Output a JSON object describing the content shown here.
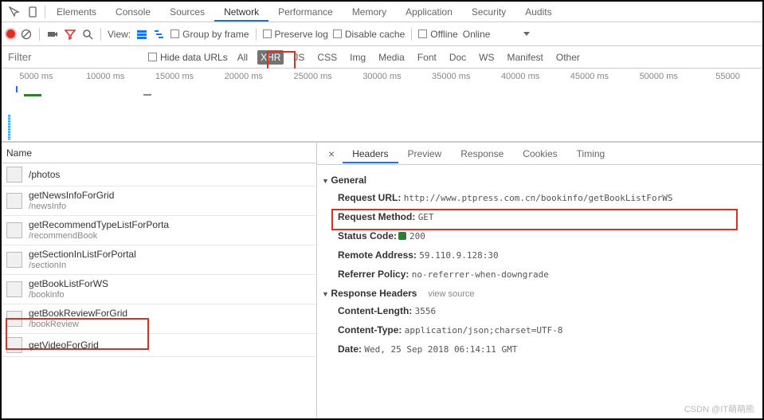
{
  "top_tabs": {
    "t0": "Elements",
    "t1": "Console",
    "t2": "Sources",
    "t3": "Network",
    "t4": "Performance",
    "t5": "Memory",
    "t6": "Application",
    "t7": "Security",
    "t8": "Audits"
  },
  "toolbar": {
    "view": "View:",
    "group": "Group by frame",
    "preserve": "Preserve log",
    "disable": "Disable cache",
    "offline": "Offline",
    "online": "Online"
  },
  "filter": {
    "placeholder": "Filter",
    "hide": "Hide data URLs",
    "types": {
      "all": "All",
      "xhr": "XHR",
      "js": "JS",
      "css": "CSS",
      "img": "Img",
      "media": "Media",
      "font": "Font",
      "doc": "Doc",
      "ws": "WS",
      "manifest": "Manifest",
      "other": "Other"
    }
  },
  "timeline": {
    "labels": [
      "5000 ms",
      "10000 ms",
      "15000 ms",
      "20000 ms",
      "25000 ms",
      "30000 ms",
      "35000 ms",
      "40000 ms",
      "45000 ms",
      "50000 ms",
      "55000"
    ]
  },
  "left": {
    "header": "Name"
  },
  "requests": [
    {
      "name": "/photos",
      "sub": ""
    },
    {
      "name": "getNewsInfoForGrid",
      "sub": "/newsInfo"
    },
    {
      "name": "getRecommendTypeListForPorta",
      "sub": "/recommendBook"
    },
    {
      "name": "getSectionInListForPortal",
      "sub": "/sectionIn"
    },
    {
      "name": "getBookListForWS",
      "sub": "/bookinfo"
    },
    {
      "name": "getBookReviewForGrid",
      "sub": "/bookReview"
    },
    {
      "name": "getVideoForGrid",
      "sub": ""
    }
  ],
  "detail_tabs": {
    "headers": "Headers",
    "preview": "Preview",
    "response": "Response",
    "cookies": "Cookies",
    "timing": "Timing"
  },
  "general": {
    "title": "General",
    "url_k": "Request URL:",
    "url_v": "http://www.ptpress.com.cn/bookinfo/getBookListForWS",
    "method_k": "Request Method:",
    "method_v": "GET",
    "status_k": "Status Code:",
    "status_v": "200",
    "remote_k": "Remote Address:",
    "remote_v": "59.110.9.128:30",
    "ref_k": "Referrer Policy:",
    "ref_v": "no-referrer-when-downgrade"
  },
  "resp": {
    "title": "Response Headers",
    "sub": "view source",
    "cl_k": "Content-Length:",
    "cl_v": "3556",
    "ct_k": "Content-Type:",
    "ct_v": "application/json;charset=UTF-8",
    "dt_k": "Date:",
    "dt_v": "Wed, 25 Sep 2018 06:14:11 GMT"
  },
  "watermark": "CSDN @IT萌萌熊"
}
